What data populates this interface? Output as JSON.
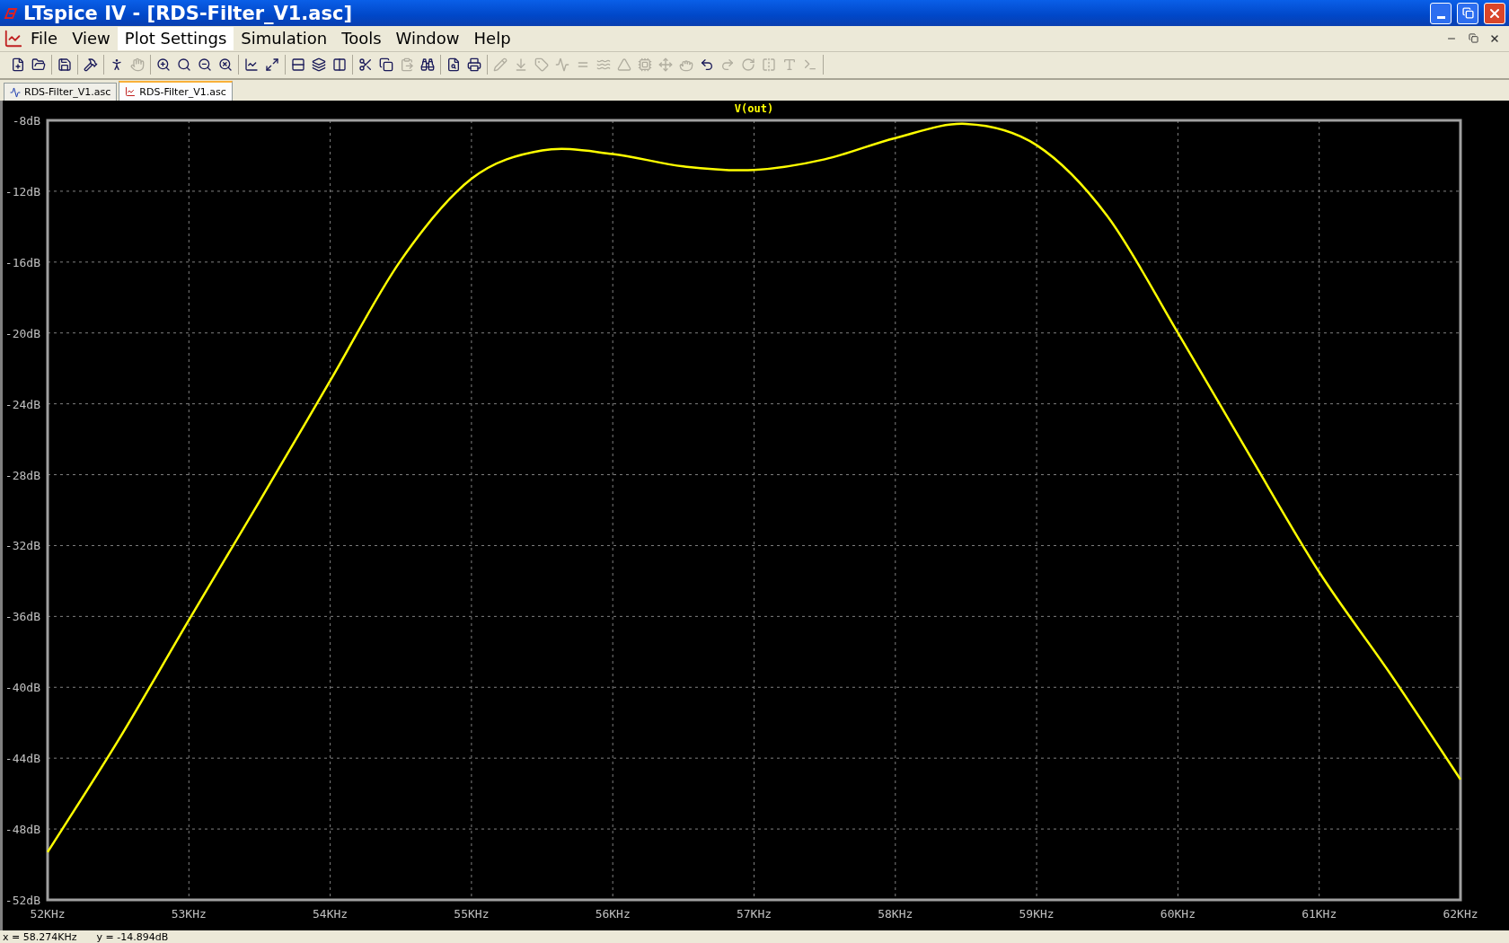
{
  "window": {
    "title": "LTspice IV - [RDS-Filter_V1.asc]"
  },
  "menu": [
    {
      "label": "File",
      "selected": false
    },
    {
      "label": "View",
      "selected": false
    },
    {
      "label": "Plot Settings",
      "selected": true
    },
    {
      "label": "Simulation",
      "selected": false
    },
    {
      "label": "Tools",
      "selected": false
    },
    {
      "label": "Window",
      "selected": false
    },
    {
      "label": "Help",
      "selected": false
    }
  ],
  "toolbar": [
    [
      {
        "disabled": false
      },
      {
        "disabled": false
      }
    ],
    [
      {
        "disabled": false
      }
    ],
    [
      {
        "disabled": false
      }
    ],
    [
      {
        "disabled": false
      },
      {
        "disabled": true
      }
    ],
    [
      {
        "disabled": false
      },
      {
        "disabled": false
      },
      {
        "disabled": false
      },
      {
        "disabled": false
      }
    ],
    [
      {
        "disabled": false
      },
      {
        "disabled": false
      }
    ],
    [
      {
        "disabled": false
      },
      {
        "disabled": false
      },
      {
        "disabled": false
      }
    ],
    [
      {
        "disabled": false
      },
      {
        "disabled": false
      },
      {
        "disabled": true
      },
      {
        "disabled": false
      }
    ],
    [
      {
        "disabled": false
      },
      {
        "disabled": false
      }
    ],
    [
      {
        "disabled": true
      },
      {
        "disabled": true
      },
      {
        "disabled": true
      },
      {
        "disabled": true
      },
      {
        "disabled": true
      },
      {
        "disabled": true
      },
      {
        "disabled": true
      },
      {
        "disabled": true
      },
      {
        "disabled": true
      },
      {
        "disabled": true
      },
      {
        "disabled": false
      },
      {
        "disabled": true
      },
      {
        "disabled": true
      },
      {
        "disabled": true
      },
      {
        "disabled": true
      },
      {
        "disabled": true
      }
    ]
  ],
  "tabs": [
    {
      "label": "RDS-Filter_V1.asc",
      "kind": "schematic",
      "selected": false
    },
    {
      "label": "RDS-Filter_V1.asc",
      "kind": "plot",
      "selected": true
    }
  ],
  "plot": {
    "chart_data": {
      "type": "line",
      "grid": true,
      "x": [
        52,
        52.5,
        53,
        53.5,
        54,
        54.5,
        55,
        55.5,
        56,
        56.5,
        57,
        57.5,
        58,
        58.5,
        59,
        59.5,
        60,
        60.5,
        61,
        61.5,
        62
      ],
      "series": [
        {
          "name": "V(out)",
          "color": "#ffff00",
          "values": [
            -49.3,
            -43,
            -36.2,
            -29.5,
            -22.7,
            -15.9,
            -11.3,
            -9.7,
            -9.9,
            -10.6,
            -10.8,
            -10.2,
            -9.0,
            -8.2,
            -9.4,
            -13.4,
            -20,
            -26.8,
            -33.5,
            -39.2,
            -45.2
          ]
        }
      ],
      "xlim": [
        52,
        62
      ],
      "ylim": [
        -52,
        -8
      ],
      "xticks": [
        {
          "value": 52,
          "label": "52KHz"
        },
        {
          "value": 53,
          "label": "53KHz"
        },
        {
          "value": 54,
          "label": "54KHz"
        },
        {
          "value": 55,
          "label": "55KHz"
        },
        {
          "value": 56,
          "label": "56KHz"
        },
        {
          "value": 57,
          "label": "57KHz"
        },
        {
          "value": 58,
          "label": "58KHz"
        },
        {
          "value": 59,
          "label": "59KHz"
        },
        {
          "value": 60,
          "label": "60KHz"
        },
        {
          "value": 61,
          "label": "61KHz"
        },
        {
          "value": 62,
          "label": "62KHz"
        }
      ],
      "yticks": [
        {
          "value": -8,
          "label": "-8dB"
        },
        {
          "value": -12,
          "label": "-12dB"
        },
        {
          "value": -16,
          "label": "-16dB"
        },
        {
          "value": -20,
          "label": "-20dB"
        },
        {
          "value": -24,
          "label": "-24dB"
        },
        {
          "value": -28,
          "label": "-28dB"
        },
        {
          "value": -32,
          "label": "-32dB"
        },
        {
          "value": -36,
          "label": "-36dB"
        },
        {
          "value": -40,
          "label": "-40dB"
        },
        {
          "value": -44,
          "label": "-44dB"
        },
        {
          "value": -48,
          "label": "-48dB"
        },
        {
          "value": -52,
          "label": "-52dB"
        }
      ]
    }
  },
  "status_bar": {
    "x_reading": "x = 58.274KHz",
    "y_reading": "y = -14.894dB"
  }
}
